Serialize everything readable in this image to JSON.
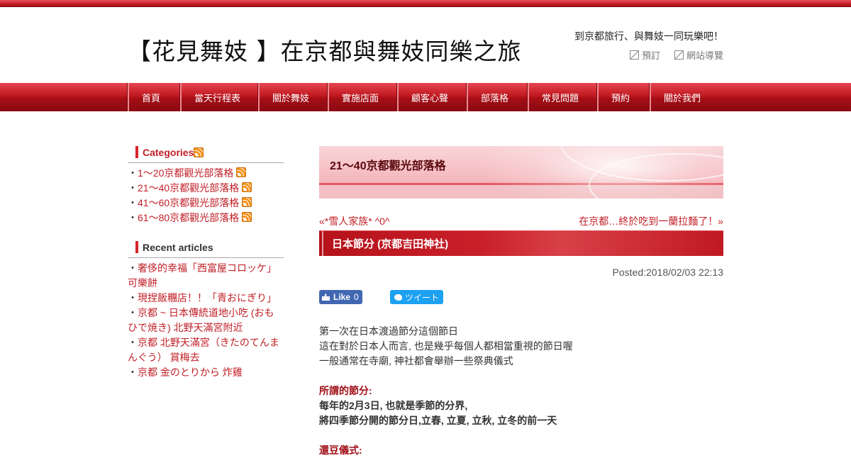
{
  "header": {
    "site_title": "【花見舞妓 】在京都與舞妓同樂之旅",
    "tagline": "到京都旅行、與舞妓一同玩樂吧！",
    "util_links": [
      "預訂",
      "網站導覽"
    ]
  },
  "nav": {
    "items": [
      "首頁",
      "當天行程表",
      "關於舞妓",
      "實施店面",
      "顧客心聲",
      "部落格",
      "常見問題",
      "預約",
      "關於我們"
    ]
  },
  "sidebar": {
    "categories_heading": "Categories",
    "categories": [
      "1～20京都觀光部落格",
      "21～40京都觀光部落格",
      "41～60京都觀光部落格",
      "61～80京都觀光部落格"
    ],
    "recent_heading": "Recent articles",
    "recent": [
      "奢侈的幸福「西富屋コロッケ」可樂餅",
      "現捏飯糰店！！「青おにぎり」",
      "京都 ~ 日本傳統道地小吃 (おもひで焼き) 北野天滿宮附近",
      "京都 北野天滿宮（きたのてんまんぐう） 賞梅去",
      "京都 金のとりから 炸雞"
    ],
    "bullet": "・"
  },
  "main": {
    "banner_title": "21～40京都觀光部落格",
    "prev_link": "«*雪人家族* ^0^",
    "next_link": "在京都…終於吃到一蘭拉麵了！»",
    "post_title": "日本節分 (京都吉田神社)",
    "posted": "Posted:2018/02/03 22:13",
    "fb_like_label": "Like",
    "fb_like_count": "0",
    "tweet_label": "ツイート",
    "paragraph1": [
      "第一次在日本渡過節分這個節日",
      "這在對於日本人而言, 也是幾乎每個人都相當重視的節日喔",
      "一般通常在寺廟, 神社都會舉辦一些祭典儀式"
    ],
    "section_heading": "所謂的節分:",
    "paragraph2": [
      "每年的2月3日, 也就是季節的分界,",
      "將四季節分開的節分日,立春, 立夏, 立秋, 立冬的前一天"
    ],
    "next_heading": "還豆儀式:"
  }
}
